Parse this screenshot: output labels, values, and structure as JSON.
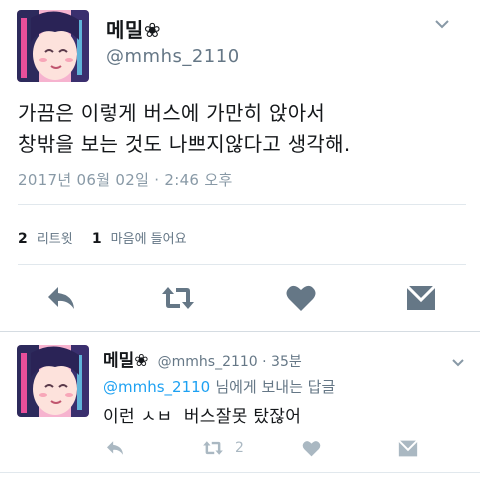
{
  "tweet": {
    "display_name": "메밀",
    "name_emoji": "❀",
    "handle": "@mmhs_2110",
    "text_line1": "가끔은 이렇게 버스에 가만히 앉아서",
    "text_line2": "창밖을 보는 것도 나쁘지않다고 생각해.",
    "timestamp": "2017년 06월 02일 · 2:46 오후",
    "retweet_count": "2",
    "retweet_label": "리트윗",
    "like_count": "1",
    "like_label": "마음에 들어요"
  },
  "reply": {
    "display_name": "메밀",
    "name_emoji": "❀",
    "handle_time": "@mmhs_2110 · 35분",
    "mention": "@mmhs_2110",
    "reply_suffix": "님에게 보내는 답글",
    "text": "이런 ㅅㅂ  버스잘못 탔잖어",
    "retweet_count": "2"
  },
  "icons": {
    "chevron": "chevron-down-icon",
    "reply": "reply-icon",
    "retweet": "retweet-icon",
    "like": "heart-icon",
    "dm": "envelope-icon"
  },
  "colors": {
    "icon_main": "#657786",
    "icon_light": "#aab8c2",
    "link": "#1da1f2",
    "divider": "#e1e8ed"
  }
}
